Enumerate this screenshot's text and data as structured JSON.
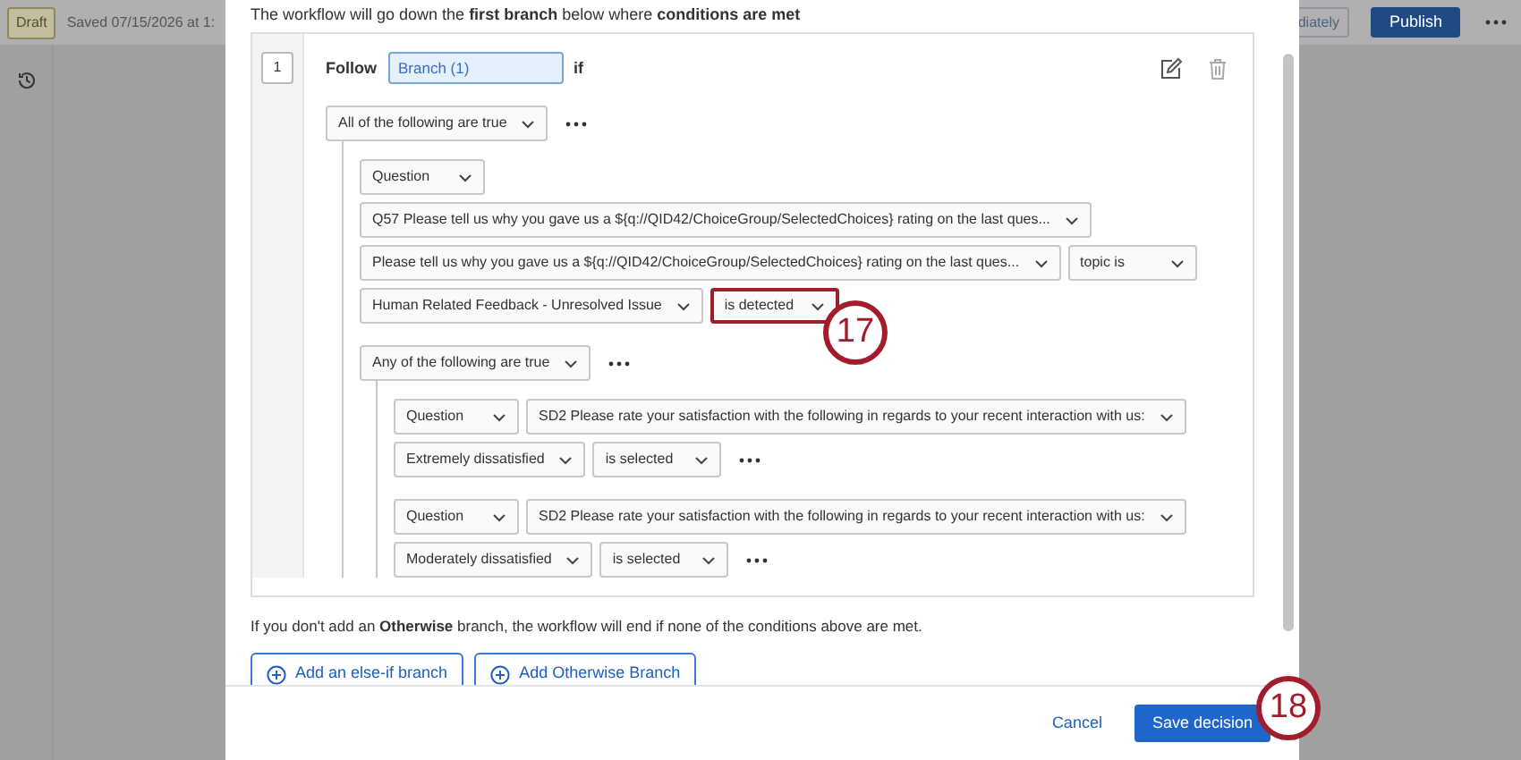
{
  "top_bar": {
    "status_badge": "Draft",
    "saved_text": "Saved 07/15/2026 at 1:",
    "cut_button": "diately",
    "publish_button": "Publish"
  },
  "modal": {
    "intro": "The workflow will go down the **first branch** below where **conditions are met**",
    "branch": {
      "number": "1",
      "follow_label": "Follow",
      "name": "Branch (1)",
      "if_label": "if",
      "group": {
        "logic": "All of the following are true",
        "items": [
          {
            "kind": "condition",
            "more": false,
            "rows": [
              {
                "fields": [
                  {
                    "text": "Question",
                    "highlighted": false
                  }
                ]
              },
              {
                "fields": [
                  {
                    "text": "Q57 Please tell us why you gave us a ${q://QID42/ChoiceGroup/SelectedChoices} rating on the last ques...",
                    "highlighted": false
                  }
                ]
              },
              {
                "fields": [
                  {
                    "text": "Please tell us why you gave us a ${q://QID42/ChoiceGroup/SelectedChoices} rating on the last ques...",
                    "highlighted": false
                  },
                  {
                    "text": "topic is",
                    "highlighted": false
                  }
                ]
              },
              {
                "fields": [
                  {
                    "text": "Human Related Feedback - Unresolved Issue",
                    "highlighted": false
                  },
                  {
                    "text": "is detected",
                    "highlighted": true
                  }
                ]
              }
            ]
          },
          {
            "kind": "group",
            "logic": "Any of the following are true",
            "items": [
              {
                "kind": "condition",
                "more": true,
                "rows": [
                  {
                    "fields": [
                      {
                        "text": "Question",
                        "highlighted": false
                      },
                      {
                        "text": "SD2 Please rate your satisfaction with the following in regards to your recent interaction with us:",
                        "highlighted": false
                      }
                    ]
                  },
                  {
                    "fields": [
                      {
                        "text": "Extremely dissatisfied",
                        "highlighted": false
                      },
                      {
                        "text": "is selected",
                        "highlighted": false
                      }
                    ]
                  }
                ]
              },
              {
                "kind": "condition",
                "more": true,
                "rows": [
                  {
                    "fields": [
                      {
                        "text": "Question",
                        "highlighted": false
                      },
                      {
                        "text": "SD2 Please rate your satisfaction with the following in regards to your recent interaction with us:",
                        "highlighted": false
                      }
                    ]
                  },
                  {
                    "fields": [
                      {
                        "text": "Moderately dissatisfied",
                        "highlighted": false
                      },
                      {
                        "text": "is selected",
                        "highlighted": false
                      }
                    ]
                  }
                ]
              }
            ]
          }
        ]
      }
    },
    "note": "If you don't add an **Otherwise** branch, the workflow will end if none of the conditions above are met.",
    "add_buttons": [
      "Add an else-if branch",
      "Add Otherwise Branch"
    ],
    "cancel": "Cancel",
    "save": "Save decision"
  },
  "annotations": [
    {
      "label": "17"
    },
    {
      "label": "18"
    }
  ]
}
